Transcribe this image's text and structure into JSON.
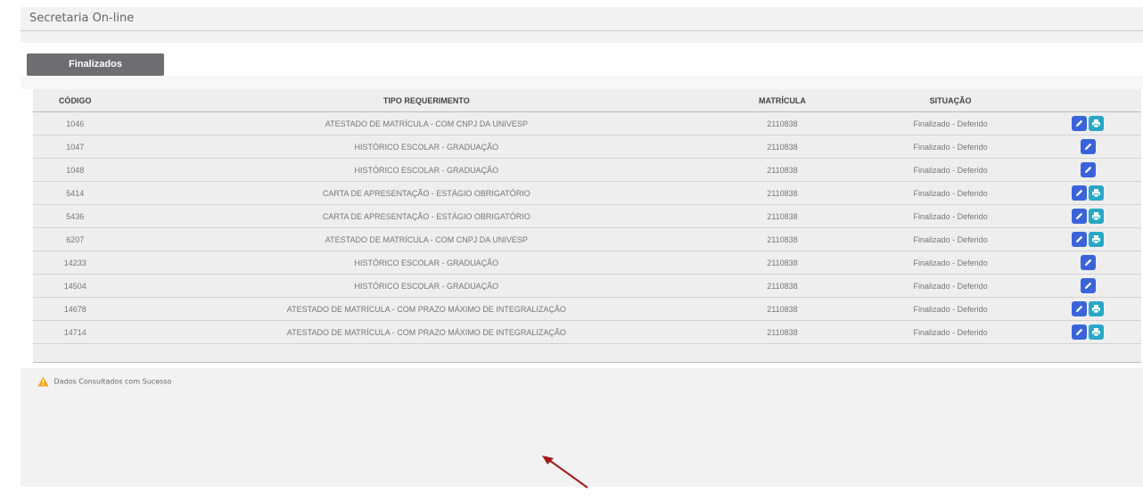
{
  "app_title": "Secretaria On-line",
  "tab": {
    "label": "Finalizados"
  },
  "table": {
    "headers": {
      "code": "CÓDIGO",
      "type": "TIPO REQUERIMENTO",
      "matricula": "MATRÍCULA",
      "situacao": "SITUAÇÃO"
    },
    "rows": [
      {
        "code": "1046",
        "type": "ATESTADO DE MATRÍCULA - COM CNPJ DA UNIVESP",
        "matricula": "2110838",
        "situacao": "Finalizado - Deferido",
        "print": true
      },
      {
        "code": "1047",
        "type": "HISTÓRICO ESCOLAR - GRADUAÇÃO",
        "matricula": "2110838",
        "situacao": "Finalizado - Deferido",
        "print": false
      },
      {
        "code": "1048",
        "type": "HISTÓRICO ESCOLAR - GRADUAÇÃO",
        "matricula": "2110838",
        "situacao": "Finalizado - Deferido",
        "print": false
      },
      {
        "code": "5414",
        "type": "CARTA DE APRESENTAÇÃO - ESTÁGIO OBRIGATÓRIO",
        "matricula": "2110838",
        "situacao": "Finalizado - Deferido",
        "print": true
      },
      {
        "code": "5436",
        "type": "CARTA DE APRESENTAÇÃO - ESTÁGIO OBRIGATÓRIO",
        "matricula": "2110838",
        "situacao": "Finalizado - Deferido",
        "print": true
      },
      {
        "code": "6207",
        "type": "ATESTADO DE MATRÍCULA - COM CNPJ DA UNIVESP",
        "matricula": "2110838",
        "situacao": "Finalizado - Deferido",
        "print": true
      },
      {
        "code": "14233",
        "type": "HISTÓRICO ESCOLAR - GRADUAÇÃO",
        "matricula": "2110838",
        "situacao": "Finalizado - Deferido",
        "print": false
      },
      {
        "code": "14504",
        "type": "HISTÓRICO ESCOLAR - GRADUAÇÃO",
        "matricula": "2110838",
        "situacao": "Finalizado - Deferido",
        "print": false
      },
      {
        "code": "14678",
        "type": "ATESTADO DE MATRÍCULA - COM PRAZO MÁXIMO DE INTEGRALIZAÇÃO",
        "matricula": "2110838",
        "situacao": "Finalizado - Deferido",
        "print": true
      },
      {
        "code": "14714",
        "type": "ATESTADO DE MATRÍCULA - COM PRAZO MÁXIMO DE INTEGRALIZAÇÃO",
        "matricula": "2110838",
        "situacao": "Finalizado - Deferido",
        "print": true
      }
    ]
  },
  "status_message": "Dados Consultados com Sucesso",
  "icons": {
    "edit": "pencil-icon",
    "print": "print-icon",
    "warning": "warning-icon",
    "annotation": "arrow-annotation"
  },
  "colors": {
    "edit_button": "#3b63d9",
    "print_button": "#28a8c7",
    "tab_bg": "#6d6e71",
    "warning": "#f5a623",
    "arrow": "#a31a1a"
  }
}
